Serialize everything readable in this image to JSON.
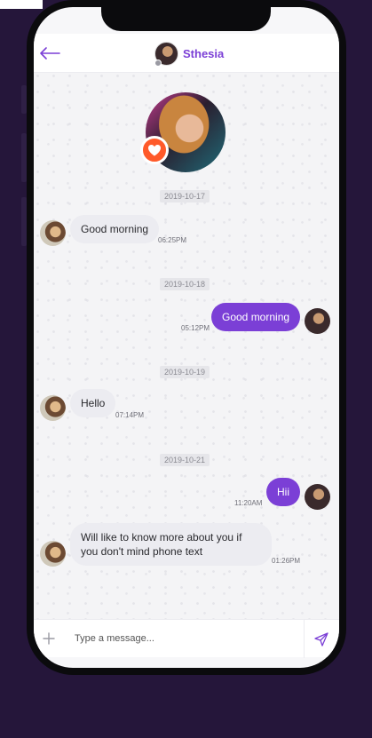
{
  "header": {
    "back_icon": "arrow-left-icon",
    "contact_name": "Sthesia",
    "accent": "#7b3fd6"
  },
  "favorite": {
    "icon": "heart-icon",
    "color": "#ff5a2a"
  },
  "messages": [
    {
      "date": "2019-10-17",
      "direction": "in",
      "text": "Good morning",
      "time": "06:25PM"
    },
    {
      "date": "2019-10-18",
      "direction": "out",
      "text": "Good morning",
      "time": "05:12PM"
    },
    {
      "date": "2019-10-19",
      "direction": "in",
      "text": "Hello",
      "time": "07:14PM"
    },
    {
      "date": "2019-10-21",
      "direction": "out",
      "text": "Hii",
      "time": "11:20AM"
    },
    {
      "date": "",
      "direction": "in",
      "text": "Will like to know more about you if you don't mind phone text",
      "time": "01:26PM"
    }
  ],
  "composer": {
    "plus_icon": "plus-icon",
    "placeholder": "Type a message...",
    "value": "",
    "send_icon": "send-icon"
  },
  "colors": {
    "outgoing_bubble": "#7b3fd6",
    "incoming_bubble": "#ececf1",
    "frame_background": "#25163a"
  }
}
